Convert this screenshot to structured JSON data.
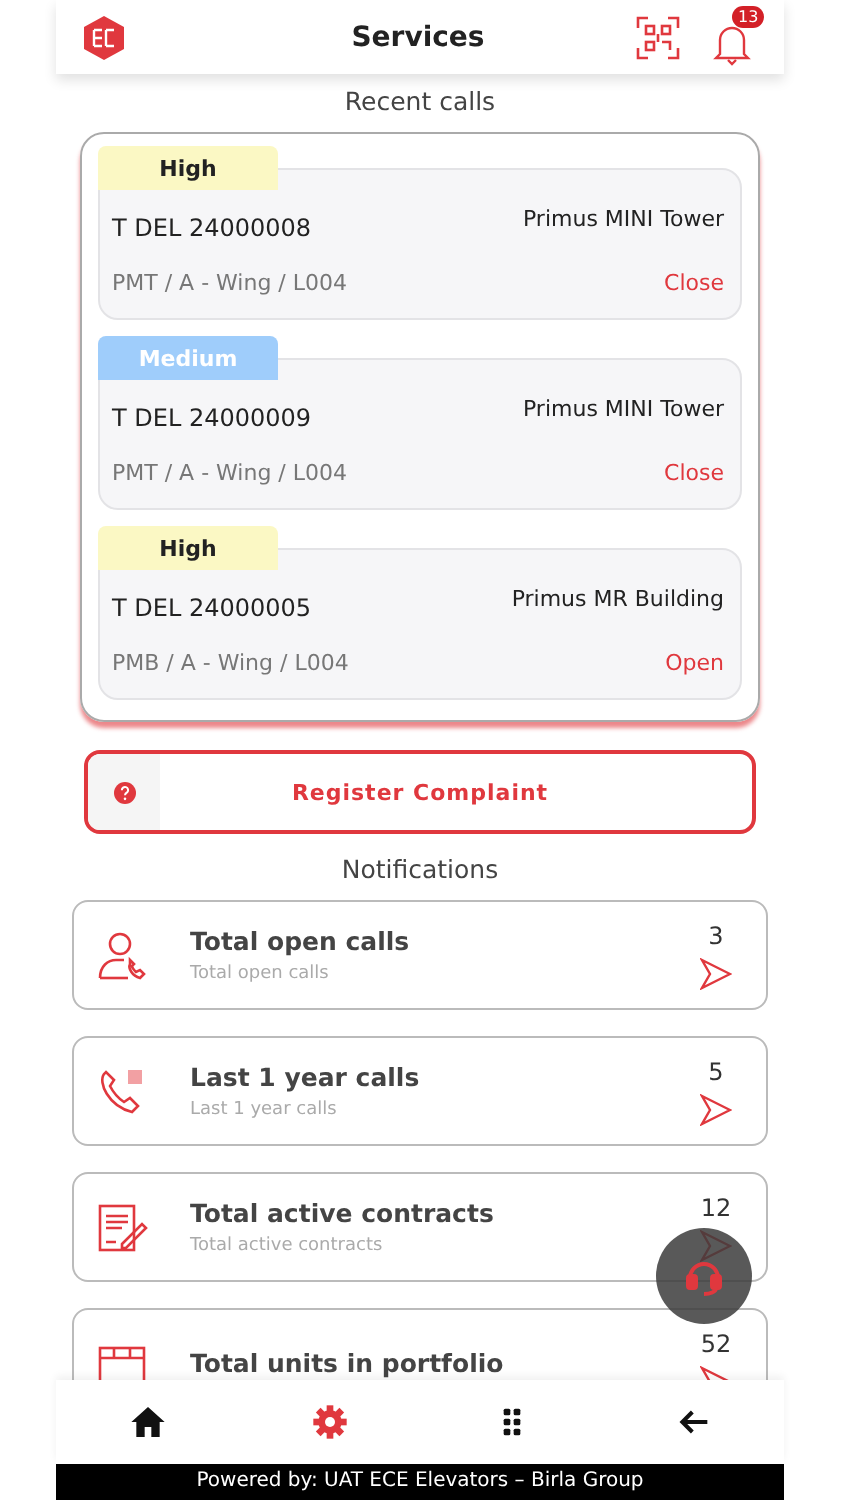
{
  "header": {
    "title": "Services",
    "badge": "13"
  },
  "recent_calls": {
    "title": "Recent calls",
    "items": [
      {
        "priority": "High",
        "color": "#fbf8c4",
        "id": "T DEL 24000008",
        "building": "Primus MINI Tower",
        "location": "PMT / A - Wing / L004",
        "status": "Close"
      },
      {
        "priority": "Medium",
        "color": "#9fcdfb",
        "id": "T DEL 24000009",
        "building": "Primus MINI Tower",
        "location": "PMT / A - Wing / L004",
        "status": "Close"
      },
      {
        "priority": "High",
        "color": "#fbf8c4",
        "id": "T DEL 24000005",
        "building": "Primus MR Building",
        "location": "PMB / A - Wing / L004",
        "status": "Open"
      }
    ]
  },
  "register_button": "Register Complaint",
  "notifications": {
    "title": "Notifications",
    "items": [
      {
        "kind": "open",
        "title": "Total open calls",
        "subtitle": "Total open calls",
        "count": "3"
      },
      {
        "kind": "year",
        "title": "Last 1 year calls",
        "subtitle": "Last 1 year calls",
        "count": "5"
      },
      {
        "kind": "contract",
        "title": "Total active contracts",
        "subtitle": "Total active contracts",
        "count": "12"
      },
      {
        "kind": "units",
        "title": "Total units in portfolio",
        "count": "52"
      }
    ]
  },
  "bottom_nav": [
    {
      "kind": "home",
      "selected": false
    },
    {
      "kind": "settings",
      "selected": true
    },
    {
      "kind": "apps",
      "selected": false
    },
    {
      "kind": "back",
      "selected": false
    }
  ],
  "footer": "Powered by: UAT ECE Elevators – Birla Group"
}
